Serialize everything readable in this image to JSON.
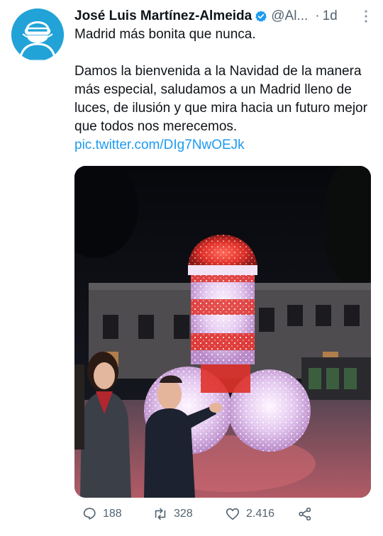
{
  "tweet": {
    "author_name": "José Luis Martínez-Almeida",
    "handle": "@Al...",
    "separator": "·",
    "time": "1d",
    "text_line1": "Madrid más bonita que nunca.",
    "text_body": "Damos la bienvenida a la Navidad de la manera más especial, saludamos a un Madrid lleno de luces, de ilusión y que mira hacia un futuro mejor que todos nos merecemos.",
    "link": "pic.twitter.com/DIg7NwOEJk"
  },
  "icons": {
    "avatar": "masked-man-avatar",
    "verified": "verified-badge-icon",
    "more": "more-vertical-icon",
    "reply": "reply-icon",
    "retweet": "retweet-icon",
    "like": "heart-icon",
    "share": "share-icon"
  },
  "actions": {
    "replies": "188",
    "retweets": "328",
    "likes": "2.416"
  },
  "colors": {
    "accent": "#1d9bf0",
    "avatar_bg": "#21a3d8",
    "secondary_text": "#536471"
  }
}
